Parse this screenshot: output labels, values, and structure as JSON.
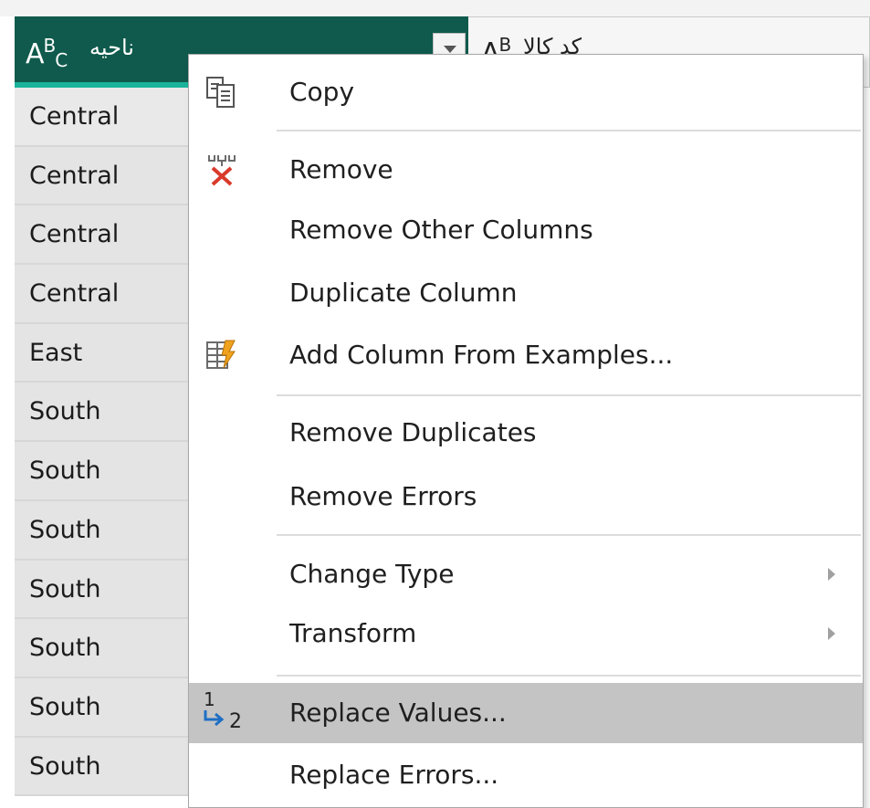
{
  "grid": {
    "active_column": {
      "type_glyph": "A",
      "type_glyph_sup": "B",
      "type_glyph_sub": "C",
      "title": "ناحیه"
    },
    "next_column": {
      "type_glyph": "A",
      "type_glyph_sup": "B",
      "type_glyph_sub": "",
      "title": "کد کالا"
    },
    "rows": [
      "Central",
      "Central",
      "Central",
      "Central",
      "East",
      "South",
      "South",
      "South",
      "South",
      "South",
      "South",
      "South"
    ]
  },
  "context_menu": {
    "items": {
      "copy": {
        "label": "Copy",
        "icon": "copy-icon"
      },
      "remove": {
        "label": "Remove",
        "icon": "remove-column-icon"
      },
      "remove_other_columns": {
        "label": "Remove Other Columns"
      },
      "duplicate_column": {
        "label": "Duplicate Column"
      },
      "add_column_from_examples": {
        "label": "Add Column From Examples...",
        "icon": "column-from-examples-icon"
      },
      "remove_duplicates": {
        "label": "Remove Duplicates"
      },
      "remove_errors": {
        "label": "Remove Errors"
      },
      "change_type": {
        "label": "Change Type",
        "has_submenu": true
      },
      "transform": {
        "label": "Transform",
        "has_submenu": true
      },
      "replace_values": {
        "label": "Replace Values...",
        "icon": "replace-values-icon",
        "icon_text_1": "1",
        "icon_text_2": "2",
        "highlighted": true
      },
      "replace_errors": {
        "label": "Replace Errors..."
      }
    }
  },
  "colors": {
    "header_active_bg": "#0f5a4c",
    "header_active_underline": "#18b39a",
    "menu_highlight": "#c4c4c4",
    "remove_icon_red": "#d93a2b"
  }
}
